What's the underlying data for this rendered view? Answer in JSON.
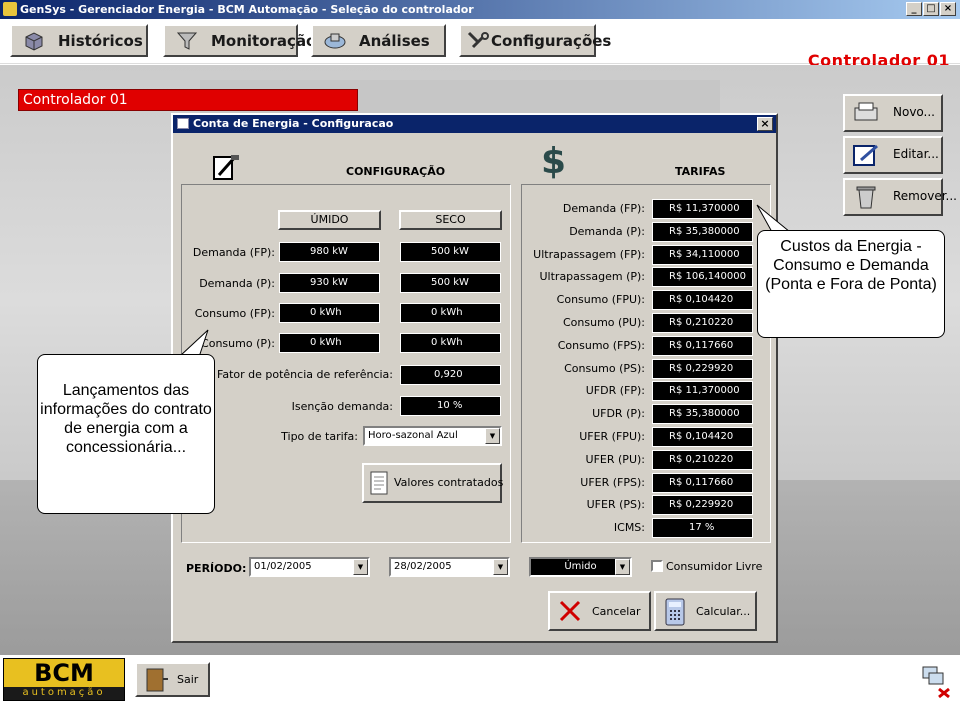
{
  "window": {
    "title": "GenSys - Gerenciador Energia - BCM Automação - Seleção do controlador"
  },
  "toolbar": {
    "buttons": [
      {
        "label": "Históricos"
      },
      {
        "label": "Monitoração"
      },
      {
        "label": "Análises"
      },
      {
        "label": "Configurações"
      }
    ],
    "controller_title": "Controlador 01"
  },
  "controller_bar": "Controlador 01",
  "right_buttons": {
    "new": "Novo...",
    "edit": "Editar...",
    "remove": "Remover..."
  },
  "dialog": {
    "title": "Conta de Energia - Configuracao",
    "config_header": "CONFIGURAÇÃO",
    "tariffs_header": "TARIFAS",
    "col_humid": "ÚMIDO",
    "col_dry": "SECO",
    "config_rows": [
      {
        "label": "Demanda (FP):",
        "humid": "980 kW",
        "dry": "500 kW"
      },
      {
        "label": "Demanda (P):",
        "humid": "930 kW",
        "dry": "500 kW"
      },
      {
        "label": "Consumo (FP):",
        "humid": "0 kWh",
        "dry": "0 kWh"
      },
      {
        "label": "Consumo (P):",
        "humid": "0 kWh",
        "dry": "0 kWh"
      }
    ],
    "power_factor_label": "Fator de potência de referência:",
    "power_factor_value": "0,920",
    "exemption_label": "Isenção demanda:",
    "exemption_value": "10 %",
    "tariff_type_label": "Tipo de tarifa:",
    "tariff_type_value": "Horo-sazonal Azul",
    "contracted_values_button": "Valores contratados",
    "tariffs": [
      {
        "label": "Demanda (FP):",
        "value": "R$ 11,370000"
      },
      {
        "label": "Demanda (P):",
        "value": "R$ 35,380000"
      },
      {
        "label": "Ultrapassagem (FP):",
        "value": "R$ 34,110000"
      },
      {
        "label": "Ultrapassagem (P):",
        "value": "R$ 106,140000"
      },
      {
        "label": "Consumo (FPU):",
        "value": "R$ 0,104420"
      },
      {
        "label": "Consumo (PU):",
        "value": "R$ 0,210220"
      },
      {
        "label": "Consumo (FPS):",
        "value": "R$ 0,117660"
      },
      {
        "label": "Consumo (PS):",
        "value": "R$ 0,229920"
      },
      {
        "label": "UFDR (FP):",
        "value": "R$ 11,370000"
      },
      {
        "label": "UFDR (P):",
        "value": "R$ 35,380000"
      },
      {
        "label": "UFER (FPU):",
        "value": "R$ 0,104420"
      },
      {
        "label": "UFER (PU):",
        "value": "R$ 0,210220"
      },
      {
        "label": "UFER (FPS):",
        "value": "R$ 0,117660"
      },
      {
        "label": "UFER (PS):",
        "value": "R$ 0,229920"
      },
      {
        "label": "ICMS:",
        "value": "17 %"
      }
    ],
    "period_label": "PERÍODO:",
    "period_start": "01/02/2005",
    "period_end": "28/02/2005",
    "season_value": "Úmido",
    "free_consumer_label": "Consumidor Livre",
    "cancel_button": "Cancelar",
    "calculate_button": "Calcular..."
  },
  "callouts": {
    "left": "Lançamentos das informações do contrato de energia com a concessionária...",
    "right": "Custos da Energia - Consumo e Demanda (Ponta e Fora de Ponta)"
  },
  "footer": {
    "logo_text": "BCM",
    "logo_sub": "automação",
    "exit_button": "Sair"
  },
  "colors": {
    "accent_red": "#e00000",
    "title_blue": "#0a246a"
  }
}
